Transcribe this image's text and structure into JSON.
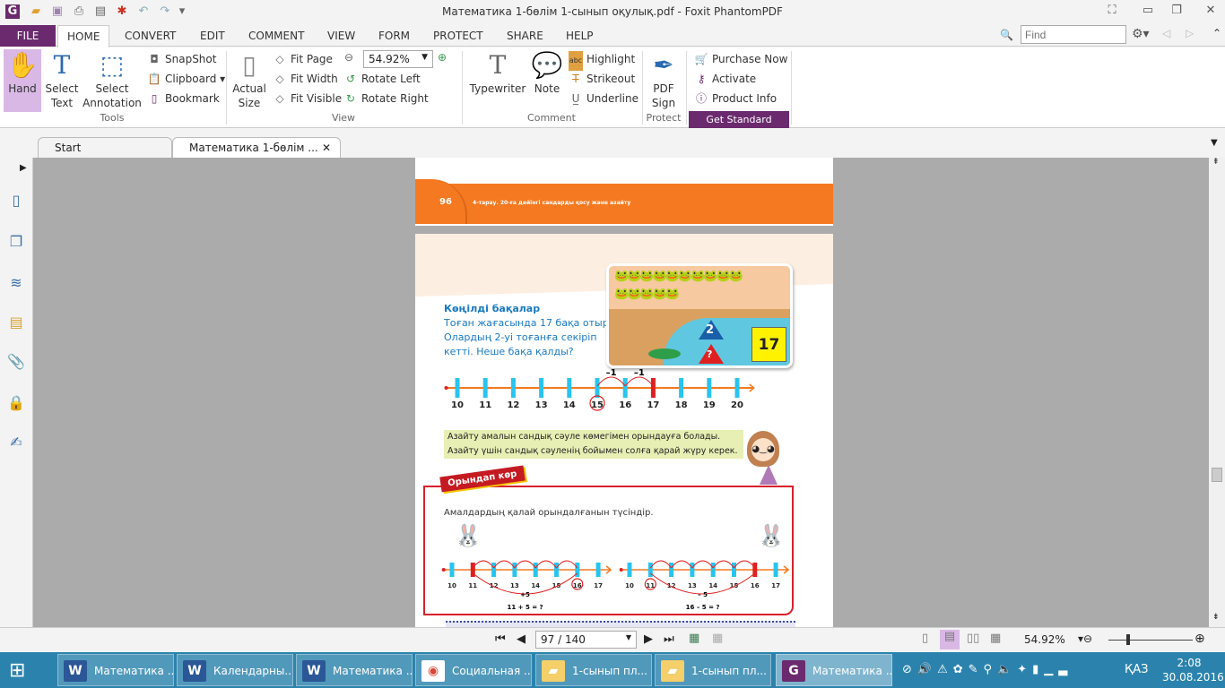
{
  "window": {
    "title": "Математика 1-бөлім 1-сынып оқулық.pdf - Foxit PhantomPDF"
  },
  "menu": {
    "tabs": [
      "FILE",
      "HOME",
      "CONVERT",
      "EDIT",
      "COMMENT",
      "VIEW",
      "FORM",
      "PROTECT",
      "SHARE",
      "HELP"
    ],
    "active": "HOME",
    "find_placeholder": "Find"
  },
  "ribbon": {
    "tools": {
      "hand": "Hand",
      "select_text": "Select\nText",
      "select_annotation": "Select\nAnnotation",
      "snapshot": "SnapShot",
      "clipboard": "Clipboard",
      "bookmark": "Bookmark",
      "group": "Tools"
    },
    "view": {
      "actual_size": "Actual\nSize",
      "fit_page": "Fit Page",
      "fit_width": "Fit Width",
      "fit_visible": "Fit Visible",
      "zoom": "54.92%",
      "rotate_left": "Rotate Left",
      "rotate_right": "Rotate Right",
      "group": "View"
    },
    "comment": {
      "typewriter": "Typewriter",
      "note": "Note",
      "highlight": "Highlight",
      "strikeout": "Strikeout",
      "underline": "Underline",
      "group": "Comment"
    },
    "protect": {
      "pdf_sign": "PDF\nSign",
      "group": "Protect"
    },
    "purchase": {
      "purchase_now": "Purchase Now",
      "activate": "Activate",
      "product_info": "Product Info",
      "get_standard": "Get Standard"
    }
  },
  "doc_tabs": [
    {
      "label": "Start"
    },
    {
      "label": "Математика 1-бөлім ..."
    }
  ],
  "page_prev": {
    "number": "96",
    "header": "4-тарау. 20-ға дейінгі сандарды қосу және азайту"
  },
  "page": {
    "problem_title": "Көңілді бақалар",
    "problem_lines": [
      "Тоған жағасында 17 бақа отыр.",
      "Олардың 2-уі тоғанға секіріп",
      "кетті. Неше бақа қалды?"
    ],
    "picture": {
      "triangle_top": "2",
      "triangle_bottom": "?",
      "total": "17"
    },
    "numberline": {
      "ticks": [
        10,
        11,
        12,
        13,
        14,
        15,
        16,
        17,
        18,
        19,
        20
      ],
      "start": 17,
      "circled": 15,
      "jump_labels": [
        "–1",
        "–1"
      ]
    },
    "note_lines": [
      "Азайту амалын сандық сәуле көмегімен орындауға болады.",
      "Азайту үшін сандық сәуленің бойымен солға қарай жүру керек."
    ],
    "banner": "Орындап көр",
    "task": "Амалдардың қалай орындалғанын түсіндір.",
    "lines": [
      {
        "ticks": [
          10,
          11,
          12,
          13,
          14,
          15,
          16,
          17
        ],
        "start": 11,
        "circled": 16,
        "jump": "+5",
        "equation": "11 + 5 = ?"
      },
      {
        "ticks": [
          10,
          11,
          12,
          13,
          14,
          15,
          16,
          17
        ],
        "start": 16,
        "circled": 11,
        "jump": "– 5",
        "equation": "16 – 5 = ?"
      }
    ]
  },
  "status": {
    "page": "97 / 140",
    "zoom": "54.92%"
  },
  "taskbar": {
    "items": [
      {
        "label": "Математика ...",
        "icon": "word-icon"
      },
      {
        "label": "Календарны...",
        "icon": "word-icon"
      },
      {
        "label": "Математика ...",
        "icon": "word-icon"
      },
      {
        "label": "Социальная ...",
        "icon": "chrome-icon"
      },
      {
        "label": "1-сынып пл...",
        "icon": "folder-icon"
      },
      {
        "label": "1-сынып пл...",
        "icon": "folder-icon"
      },
      {
        "label": "Математика ...",
        "icon": "foxit-icon"
      }
    ],
    "lang": "ҚАЗ",
    "time": "2:08",
    "date": "30.08.2016"
  },
  "colors": {
    "accent": "#6b2a6e",
    "orange": "#f47920",
    "blue_text": "#1a7ac0",
    "tick": "#29c4ee",
    "red": "#e02020"
  }
}
